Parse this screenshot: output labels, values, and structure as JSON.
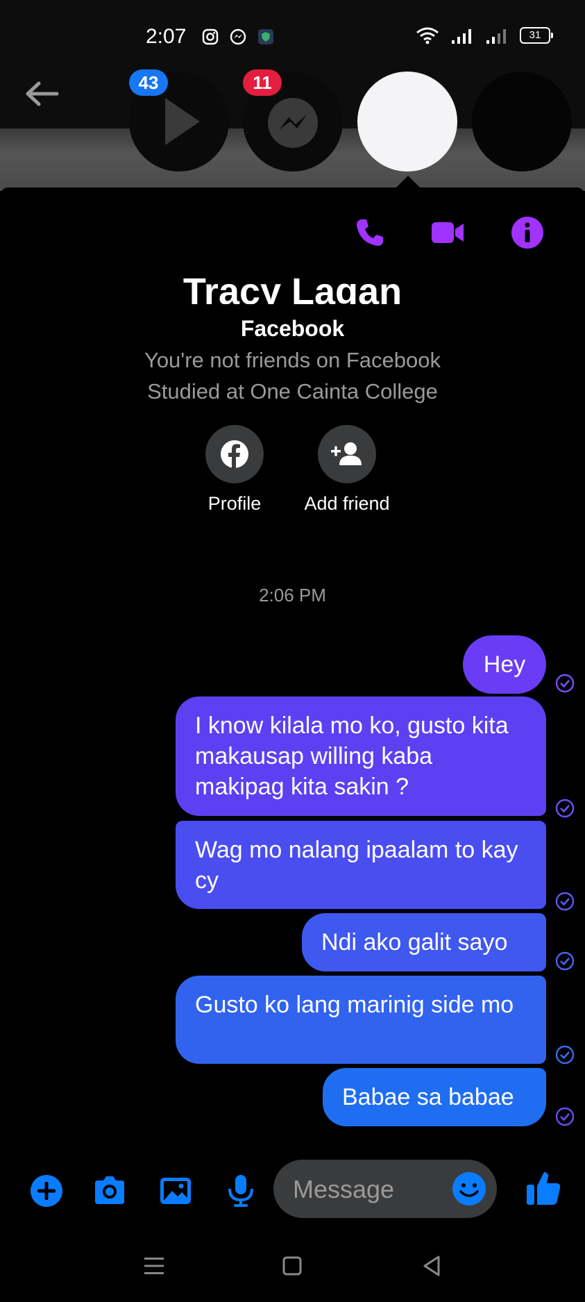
{
  "status_bar": {
    "time": "2:07",
    "battery": "31"
  },
  "chat_heads": [
    {
      "badge": "43",
      "badge_color": "#1877f2"
    },
    {
      "badge": "11",
      "badge_color": "#e41e3f"
    }
  ],
  "profile": {
    "name": "Tracy Lagan",
    "platform": "Facebook",
    "relation": "You're not friends on Facebook",
    "education": "Studied at One Cainta College",
    "profile_label": "Profile",
    "add_friend_label": "Add friend"
  },
  "timestamp": "2:06 PM",
  "messages": [
    {
      "text": "Hey"
    },
    {
      "text": "I know kilala mo ko, gusto kita makausap willing kaba makipag kita sakin ?"
    },
    {
      "text": "Wag mo nalang ipaalam to kay cy"
    },
    {
      "text": "Ndi ako galit sayo"
    },
    {
      "text": "Gusto ko lang marinig side mo"
    },
    {
      "text": "Babae sa babae"
    }
  ],
  "composer": {
    "placeholder": "Message"
  },
  "colors": {
    "accent_purple": "#a033ff",
    "accent_blue": "#0a7cff",
    "bubble_top": "#6a3cf5",
    "bubble_bottom": "#1f6ef2"
  }
}
